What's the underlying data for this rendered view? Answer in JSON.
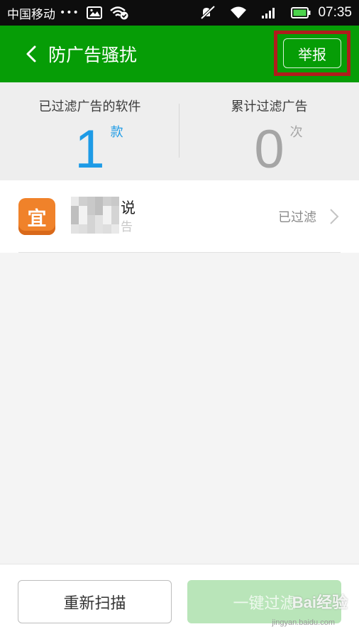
{
  "status_bar": {
    "carrier": "中国移动",
    "dots": "•••",
    "time": "07:35"
  },
  "app_bar": {
    "title": "防广告骚扰",
    "report_label": "举报"
  },
  "stats": {
    "filtered_apps": {
      "label": "已过滤广告的软件",
      "value": "1",
      "unit": "款"
    },
    "filtered_ads": {
      "label": "累计过滤广告",
      "value": "0",
      "unit": "次"
    }
  },
  "list": {
    "items": [
      {
        "icon_glyph": "宜",
        "name": "说",
        "subtitle": "告",
        "status": "已过滤"
      }
    ]
  },
  "bottom": {
    "rescan_label": "重新扫描",
    "filter_label": "一键过滤"
  },
  "watermark": {
    "text": "Bai经验",
    "sub": "jingyan.baidu.com"
  },
  "colors": {
    "app_bar": "#069d06",
    "accent_blue": "#1e9be6",
    "highlight_red": "#b01c1c",
    "app_icon": "#f0822a"
  }
}
